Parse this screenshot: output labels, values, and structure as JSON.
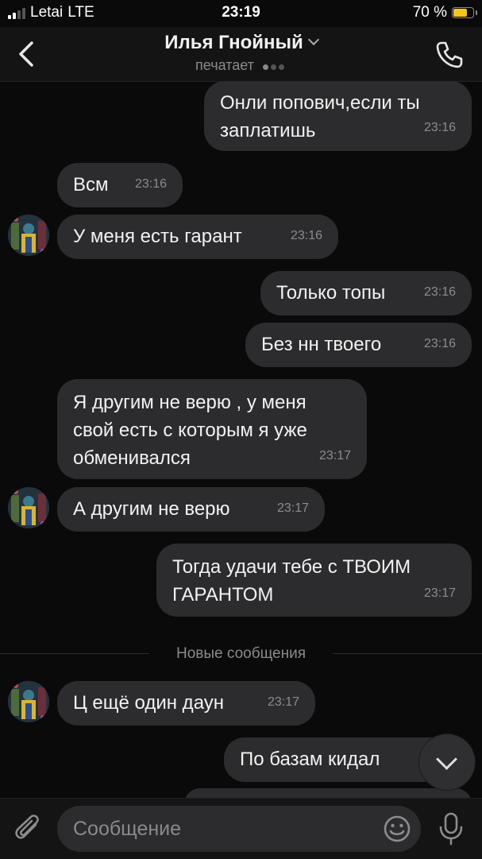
{
  "status_bar": {
    "carrier": "Letai",
    "network": "LTE",
    "time": "23:19",
    "battery": "70 %",
    "battery_level": 0.7
  },
  "header": {
    "title": "Илья Гнойный",
    "subtitle": "печатает"
  },
  "messages": [
    {
      "text": "Онли попович,если ты\nзаплатишь",
      "time": "23:16"
    },
    {
      "text": "Всм",
      "time": "23:16"
    },
    {
      "text": "У меня есть гарант",
      "time": "23:16"
    },
    {
      "text": "Только топы",
      "time": "23:16"
    },
    {
      "text": "Без нн твоего",
      "time": "23:16"
    },
    {
      "text": "Я другим не верю , у меня\nсвой есть с которым я уже\nобменивался",
      "time": "23:17"
    },
    {
      "text": "А другим не верю",
      "time": "23:17"
    },
    {
      "text": "Тогда удачи тебе с ТВОИМ\nГАРАНТОМ",
      "time": "23:17"
    },
    {
      "text": "Ц ещё один даун",
      "time": "23:17"
    },
    {
      "text": "По базам кидал",
      "time": ""
    }
  ],
  "divider": {
    "label": "Новые сообщения"
  },
  "composer": {
    "placeholder": "Сообщение"
  },
  "icons": [
    "back-icon",
    "chevron-down-icon",
    "phone-icon",
    "chevron-down-icon",
    "paperclip-icon",
    "emoji-icon",
    "microphone-icon"
  ],
  "colors": {
    "background": "#0a0a0a",
    "bubble": "#2c2c2e",
    "header": "#141414",
    "battery": "#f5c518"
  }
}
